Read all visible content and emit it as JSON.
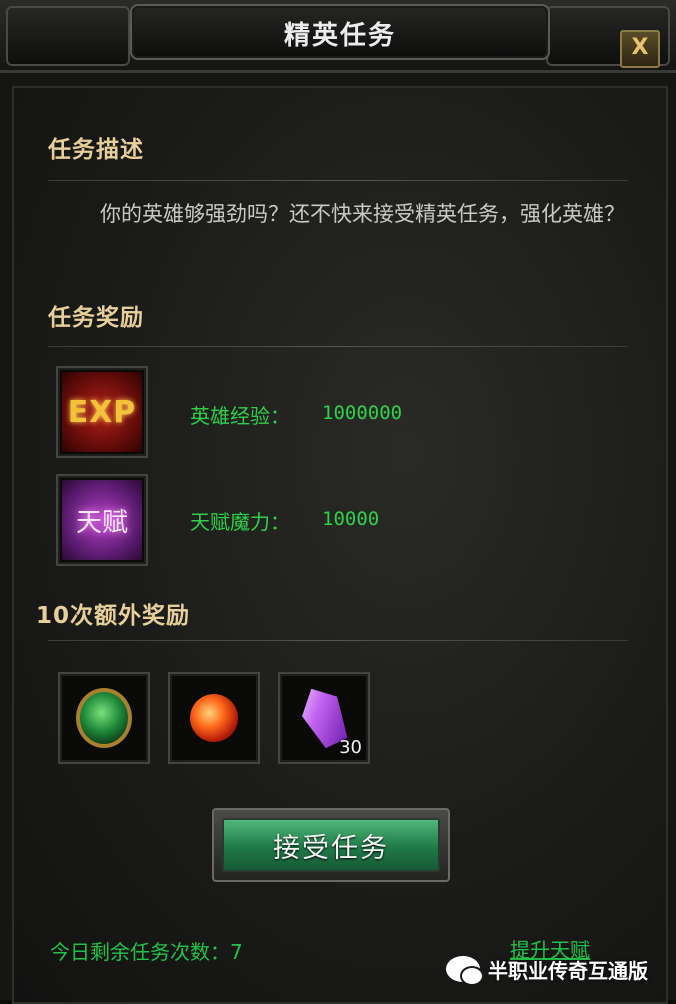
{
  "window": {
    "title": "精英任务",
    "close_label": "X"
  },
  "description": {
    "heading": "任务描述",
    "text": "你的英雄够强劲吗？还不快来接受精英任务，强化英雄？"
  },
  "rewards": {
    "heading": "任务奖励",
    "items": [
      {
        "icon": "exp-icon",
        "icon_text": "EXP",
        "label": "英雄经验：",
        "value": "1000000"
      },
      {
        "icon": "talent-icon",
        "icon_text": "天赋",
        "label": "天赋魔力：",
        "value": "10000"
      }
    ]
  },
  "bonus": {
    "heading": "10次额外奖励",
    "items": [
      {
        "icon": "green-gem-amulet-icon",
        "count": ""
      },
      {
        "icon": "fire-orb-icon",
        "count": ""
      },
      {
        "icon": "purple-crystal-icon",
        "count": "30"
      }
    ]
  },
  "actions": {
    "accept_label": "接受任务",
    "promote_label": "提升天赋"
  },
  "footer": {
    "remaining_text": "今日剩余任务次数：7"
  },
  "watermark": {
    "text": "半职业传奇互通版"
  },
  "colors": {
    "accent_green": "#2fd14a",
    "heading_gold": "#e7cf9a",
    "button_green": "#1f7a48"
  }
}
